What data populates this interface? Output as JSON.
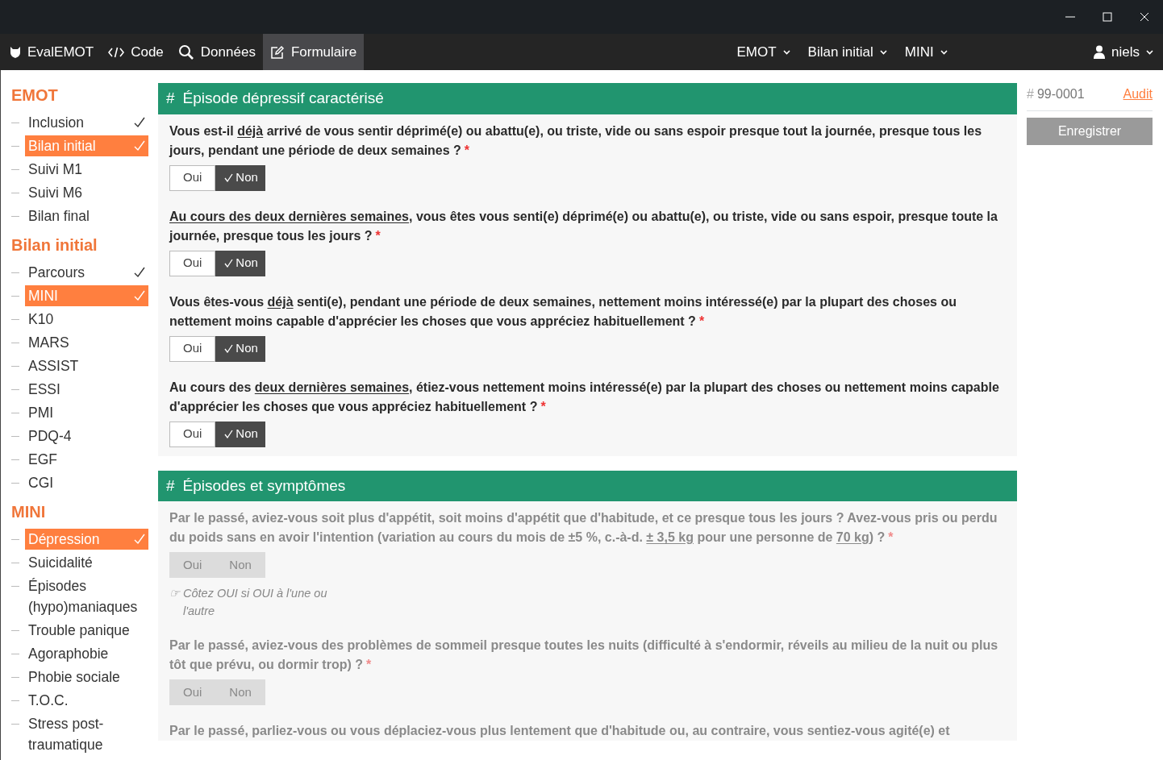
{
  "navbar": {
    "brand": "EvalEMOT",
    "links": [
      {
        "label": "Code",
        "kind": "code",
        "selected": false
      },
      {
        "label": "Données",
        "kind": "search",
        "selected": false
      },
      {
        "label": "Formulaire",
        "kind": "edit",
        "selected": true
      }
    ],
    "menus": [
      "EMOT",
      "Bilan initial",
      "MINI"
    ],
    "user": "niels"
  },
  "sidebar": [
    {
      "heading": "EMOT",
      "items": [
        {
          "label": "Inclusion",
          "selected": false,
          "done": true
        },
        {
          "label": "Bilan initial",
          "selected": true,
          "done": true
        },
        {
          "label": "Suivi M1",
          "selected": false,
          "done": false
        },
        {
          "label": "Suivi M6",
          "selected": false,
          "done": false
        },
        {
          "label": "Bilan final",
          "selected": false,
          "done": false
        }
      ]
    },
    {
      "heading": "Bilan initial",
      "items": [
        {
          "label": "Parcours",
          "selected": false,
          "done": true
        },
        {
          "label": "MINI",
          "selected": true,
          "done": true
        },
        {
          "label": "K10",
          "selected": false,
          "done": false
        },
        {
          "label": "MARS",
          "selected": false,
          "done": false
        },
        {
          "label": "ASSIST",
          "selected": false,
          "done": false
        },
        {
          "label": "ESSI",
          "selected": false,
          "done": false
        },
        {
          "label": "PMI",
          "selected": false,
          "done": false
        },
        {
          "label": "PDQ-4",
          "selected": false,
          "done": false
        },
        {
          "label": "EGF",
          "selected": false,
          "done": false
        },
        {
          "label": "CGI",
          "selected": false,
          "done": false
        }
      ]
    },
    {
      "heading": "MINI",
      "items": [
        {
          "label": "Dépression",
          "selected": true,
          "done": true
        },
        {
          "label": "Suicidalité",
          "selected": false,
          "done": false
        },
        {
          "label": "Épisodes (hypo)maniaques",
          "selected": false,
          "done": false
        },
        {
          "label": "Trouble panique",
          "selected": false,
          "done": false
        },
        {
          "label": "Agoraphobie",
          "selected": false,
          "done": false
        },
        {
          "label": "Phobie sociale",
          "selected": false,
          "done": false
        },
        {
          "label": "T.O.C.",
          "selected": false,
          "done": false
        },
        {
          "label": "Stress post-traumatique",
          "selected": false,
          "done": false
        }
      ]
    }
  ],
  "sections": [
    {
      "mark": "#",
      "title": "Épisode dépressif caractérisé",
      "questions": [
        {
          "parts": [
            {
              "text": "Vous est-il ",
              "underline": false
            },
            {
              "text": "déjà",
              "underline": true
            },
            {
              "text": " arrivé de vous sentir déprimé(e) ou abattu(e), ou triste, vide ou sans espoir presque tout la journée, presque tous les jours, pendant une période de deux semaines ?",
              "underline": false
            }
          ],
          "required": "*",
          "disabled": false,
          "options": [
            {
              "label": "Oui",
              "selected": false
            },
            {
              "label": "Non",
              "selected": true
            }
          ]
        },
        {
          "parts": [
            {
              "text": "Au cours des deux dernières semaines",
              "underline": true
            },
            {
              "text": ", vous êtes vous senti(e) déprimé(e) ou abattu(e), ou triste, vide ou sans espoir, presque toute la journée, presque tous les jours ?",
              "underline": false
            }
          ],
          "required": "*",
          "disabled": false,
          "options": [
            {
              "label": "Oui",
              "selected": false
            },
            {
              "label": "Non",
              "selected": true
            }
          ]
        },
        {
          "parts": [
            {
              "text": "Vous êtes-vous ",
              "underline": false
            },
            {
              "text": "déjà",
              "underline": true
            },
            {
              "text": " senti(e), pendant une période de deux semaines, nettement moins intéressé(e) par la plupart des choses ou nettement moins capable d'apprécier les choses que vous appréciez habituellement ?",
              "underline": false
            }
          ],
          "required": "*",
          "disabled": false,
          "options": [
            {
              "label": "Oui",
              "selected": false
            },
            {
              "label": "Non",
              "selected": true
            }
          ]
        },
        {
          "parts": [
            {
              "text": "Au cours des ",
              "underline": false
            },
            {
              "text": "deux dernières semaines",
              "underline": true
            },
            {
              "text": ", étiez-vous nettement moins intéressé(e) par la plupart des choses ou nettement moins capable d'apprécier les choses que vous appréciez habituellement ?",
              "underline": false
            }
          ],
          "required": "*",
          "disabled": false,
          "options": [
            {
              "label": "Oui",
              "selected": false
            },
            {
              "label": "Non",
              "selected": true
            }
          ]
        }
      ]
    },
    {
      "mark": "#",
      "title": "Épisodes et symptômes",
      "questions": [
        {
          "parts": [
            {
              "text": "Par le passé, aviez-vous soit plus d'appétit, soit moins d'appétit que d'habitude, et ce presque tous les jours ? Avez-vous pris ou perdu du poids sans en avoir l'intention (variation au cours du mois de ±5 %, c.-à-d. ",
              "underline": false
            },
            {
              "text": "± 3,5 kg",
              "underline": true
            },
            {
              "text": " pour une personne de ",
              "underline": false
            },
            {
              "text": "70 kg",
              "underline": true
            },
            {
              "text": ") ?",
              "underline": false
            }
          ],
          "required": "*",
          "disabled": true,
          "options": [
            {
              "label": "Oui",
              "selected": false
            },
            {
              "label": "Non",
              "selected": false
            }
          ],
          "hint": {
            "icon": "☞",
            "text": "Côtez OUI si OUI à l'une ou l'autre"
          }
        },
        {
          "parts": [
            {
              "text": "Par le passé, aviez-vous des problèmes de sommeil presque toutes les nuits (difficulté à s'endormir, réveils au milieu de la nuit ou plus tôt que prévu, ou dormir trop) ?",
              "underline": false
            }
          ],
          "required": "*",
          "disabled": true,
          "options": [
            {
              "label": "Oui",
              "selected": false
            },
            {
              "label": "Non",
              "selected": false
            }
          ]
        },
        {
          "parts": [
            {
              "text": "Par le passé, parliez-vous ou vous déplaciez-vous plus lentement que d'habitude ou, au contraire, vous sentiez-vous agité(e) et",
              "underline": false
            }
          ],
          "disabled": true
        }
      ]
    }
  ],
  "record": {
    "mark": "#",
    "id": "99-0001",
    "audit": "Audit",
    "save": "Enregistrer",
    "save_disabled": true
  }
}
